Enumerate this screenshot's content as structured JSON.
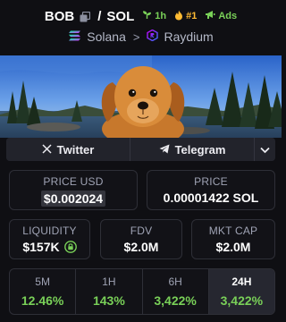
{
  "header": {
    "base_token": "BOB",
    "quote_token": "SOL",
    "age_badge": "1h",
    "rank_badge": "#1",
    "ads_badge": "Ads",
    "chain": "Solana",
    "dex": "Raydium"
  },
  "socials": {
    "twitter_label": "Twitter",
    "telegram_label": "Telegram"
  },
  "stats": {
    "price_usd_label": "PRICE USD",
    "price_usd_value": "$0.002024",
    "price_sol_label": "PRICE",
    "price_sol_value": "0.00001422 SOL",
    "liquidity_label": "LIQUIDITY",
    "liquidity_value": "$157K",
    "fdv_label": "FDV",
    "fdv_value": "$2.0M",
    "mcap_label": "MKT CAP",
    "mcap_value": "$2.0M"
  },
  "timeframes": [
    {
      "label": "5M",
      "value": "12.46%"
    },
    {
      "label": "1H",
      "value": "143%"
    },
    {
      "label": "6H",
      "value": "3,422%"
    },
    {
      "label": "24H",
      "value": "3,422%"
    }
  ],
  "colors": {
    "positive": "#79d058",
    "rank": "#ffbb33",
    "background": "#0f0f13"
  }
}
